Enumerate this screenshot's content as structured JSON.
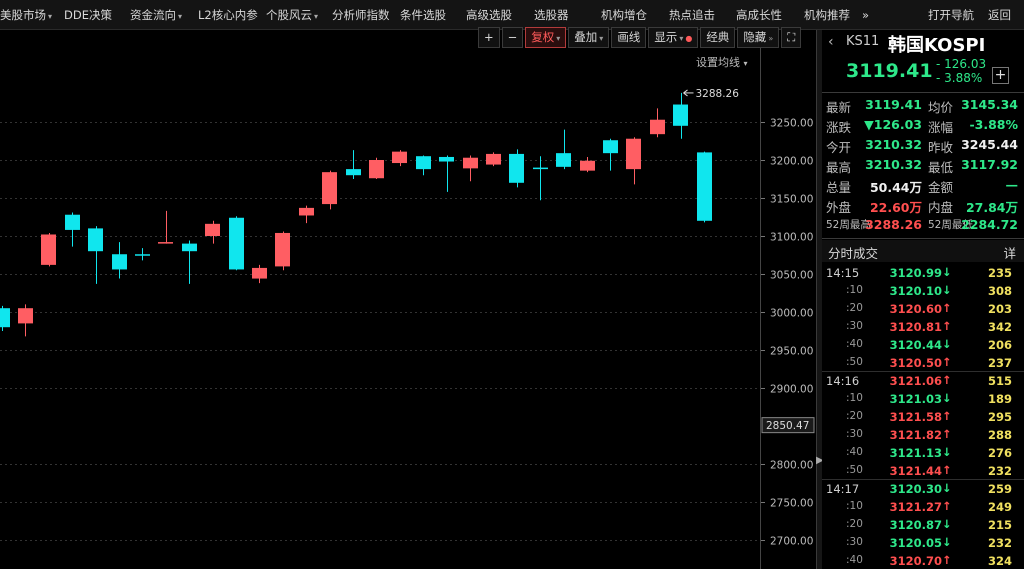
{
  "menu": [
    {
      "label": "美股市场",
      "caret": true
    },
    {
      "label": "DDE决策",
      "caret": false
    },
    {
      "label": "资金流向",
      "caret": true
    },
    {
      "label": "L2核心内参",
      "caret": false
    },
    {
      "label": "个股风云",
      "caret": true
    },
    {
      "label": "分析师指数",
      "caret": false
    },
    {
      "label": "条件选股",
      "caret": false
    },
    {
      "label": "高级选股",
      "caret": false
    },
    {
      "label": "选股器",
      "caret": false
    },
    {
      "label": "机构增仓",
      "caret": false
    },
    {
      "label": "热点追击",
      "caret": false
    },
    {
      "label": "高成长性",
      "caret": false
    },
    {
      "label": "机构推荐",
      "caret": false
    },
    {
      "label": "»",
      "caret": false
    },
    {
      "label": "打开导航",
      "caret": false
    },
    {
      "label": "返回",
      "caret": false
    }
  ],
  "toolbar": {
    "plus": "+",
    "minus": "−",
    "fuquan": "复权",
    "diejia": "叠加",
    "huaxian": "画线",
    "xianshi": "显示",
    "jingdian": "经典",
    "yincang": "隐藏",
    "more": "»",
    "expand": "⛶"
  },
  "ma_settings": "设置均线",
  "chart_data": {
    "type": "candlestick",
    "yticks": [
      3250.0,
      3200.0,
      3150.0,
      3100.0,
      3050.0,
      3000.0,
      2950.0,
      2900.0,
      2800.0,
      2750.0,
      2700.0
    ],
    "ylim": [
      2675,
      3310
    ],
    "current_price_label": "2850.47",
    "high_marker": "3288.26",
    "up_color": "#ff5e63",
    "down_color": "#10e6ee",
    "candles": [
      {
        "o": 3005,
        "c": 2980,
        "h": 3008,
        "l": 2975
      },
      {
        "o": 2985,
        "c": 3005,
        "h": 3010,
        "l": 2968
      },
      {
        "o": 3062,
        "c": 3102,
        "h": 3104,
        "l": 3060
      },
      {
        "o": 3128,
        "c": 3108,
        "h": 3131,
        "l": 3086
      },
      {
        "o": 3110,
        "c": 3080,
        "h": 3113,
        "l": 3037
      },
      {
        "o": 3076,
        "c": 3056,
        "h": 3092,
        "l": 3044
      },
      {
        "o": 3076,
        "c": 3075,
        "h": 3084,
        "l": 3068
      },
      {
        "o": 3090,
        "c": 3092,
        "h": 3133,
        "l": 3090
      },
      {
        "o": 3090,
        "c": 3080,
        "h": 3094,
        "l": 3037
      },
      {
        "o": 3100,
        "c": 3116,
        "h": 3120,
        "l": 3090
      },
      {
        "o": 3124,
        "c": 3056,
        "h": 3126,
        "l": 3055
      },
      {
        "o": 3044,
        "c": 3058,
        "h": 3062,
        "l": 3038
      },
      {
        "o": 3060,
        "c": 3104,
        "h": 3106,
        "l": 3055
      },
      {
        "o": 3127,
        "c": 3137,
        "h": 3140,
        "l": 3117
      },
      {
        "o": 3142,
        "c": 3184,
        "h": 3186,
        "l": 3135
      },
      {
        "o": 3188,
        "c": 3180,
        "h": 3213,
        "l": 3175
      },
      {
        "o": 3176,
        "c": 3200,
        "h": 3203,
        "l": 3175
      },
      {
        "o": 3196,
        "c": 3211,
        "h": 3213,
        "l": 3192
      },
      {
        "o": 3205,
        "c": 3188,
        "h": 3206,
        "l": 3180
      },
      {
        "o": 3204,
        "c": 3198,
        "h": 3206,
        "l": 3158
      },
      {
        "o": 3189,
        "c": 3203,
        "h": 3206,
        "l": 3172
      },
      {
        "o": 3194,
        "c": 3208,
        "h": 3210,
        "l": 3192
      },
      {
        "o": 3208,
        "c": 3170,
        "h": 3214,
        "l": 3164
      },
      {
        "o": 3190,
        "c": 3188,
        "h": 3205,
        "l": 3147
      },
      {
        "o": 3209,
        "c": 3191,
        "h": 3240,
        "l": 3188
      },
      {
        "o": 3186,
        "c": 3199,
        "h": 3204,
        "l": 3184
      },
      {
        "o": 3226,
        "c": 3209,
        "h": 3228,
        "l": 3186
      },
      {
        "o": 3188,
        "c": 3228,
        "h": 3230,
        "l": 3168
      },
      {
        "o": 3234,
        "c": 3253,
        "h": 3268,
        "l": 3230
      },
      {
        "o": 3273,
        "c": 3245,
        "h": 3288.26,
        "l": 3228
      },
      {
        "o": 3210,
        "c": 3120,
        "h": 3211,
        "l": 3118
      }
    ]
  },
  "panel": {
    "code": "KS11",
    "name": "韩国KOSPI",
    "price": "3119.41",
    "change": "- 126.03",
    "change_pct": "- 3.88%",
    "plus": "+",
    "stats": [
      {
        "l1": "最新",
        "v1": "3119.41",
        "c1": "green",
        "l2": "均价",
        "v2": "3145.34",
        "c2": "green"
      },
      {
        "l1": "涨跌",
        "v1": "▼126.03",
        "c1": "green",
        "l2": "涨幅",
        "v2": "-3.88%",
        "c2": "green"
      },
      {
        "l1": "今开",
        "v1": "3210.32",
        "c1": "green",
        "l2": "昨收",
        "v2": "3245.44",
        "c2": "white"
      },
      {
        "l1": "最高",
        "v1": "3210.32",
        "c1": "green",
        "l2": "最低",
        "v2": "3117.92",
        "c2": "green"
      },
      {
        "l1": "总量",
        "v1": "50.44万",
        "c1": "white",
        "l2": "金额",
        "v2": "—",
        "c2": "green"
      },
      {
        "l1": "外盘",
        "v1": "22.60万",
        "c1": "red",
        "l2": "内盘",
        "v2": "27.84万",
        "c2": "green"
      },
      {
        "l1": "52周最高",
        "v1": "3288.26",
        "c1": "red",
        "l2": "52周最低",
        "v2": "2284.72",
        "c2": "green"
      }
    ],
    "ticks_title": "分时成交",
    "ticks_detail": "详",
    "ticks": [
      {
        "time": "14:15",
        "price": "3120.99",
        "dir": "down",
        "vol": "235"
      },
      {
        "time": ":10",
        "price": "3120.10",
        "dir": "down",
        "vol": "308"
      },
      {
        "time": ":20",
        "price": "3120.60",
        "dir": "up",
        "vol": "203"
      },
      {
        "time": ":30",
        "price": "3120.81",
        "dir": "up",
        "vol": "342"
      },
      {
        "time": ":40",
        "price": "3120.44",
        "dir": "down",
        "vol": "206"
      },
      {
        "time": ":50",
        "price": "3120.50",
        "dir": "up",
        "vol": "237"
      },
      {
        "time": "14:16",
        "price": "3121.06",
        "dir": "up",
        "vol": "515"
      },
      {
        "time": ":10",
        "price": "3121.03",
        "dir": "down",
        "vol": "189"
      },
      {
        "time": ":20",
        "price": "3121.58",
        "dir": "up",
        "vol": "295"
      },
      {
        "time": ":30",
        "price": "3121.82",
        "dir": "up",
        "vol": "288"
      },
      {
        "time": ":40",
        "price": "3121.13",
        "dir": "down",
        "vol": "276"
      },
      {
        "time": ":50",
        "price": "3121.44",
        "dir": "up",
        "vol": "232"
      },
      {
        "time": "14:17",
        "price": "3120.30",
        "dir": "down",
        "vol": "259"
      },
      {
        "time": ":10",
        "price": "3121.27",
        "dir": "up",
        "vol": "249"
      },
      {
        "time": ":20",
        "price": "3120.87",
        "dir": "down",
        "vol": "215"
      },
      {
        "time": ":30",
        "price": "3120.05",
        "dir": "down",
        "vol": "232"
      },
      {
        "time": ":40",
        "price": "3120.70",
        "dir": "up",
        "vol": "324"
      }
    ]
  }
}
